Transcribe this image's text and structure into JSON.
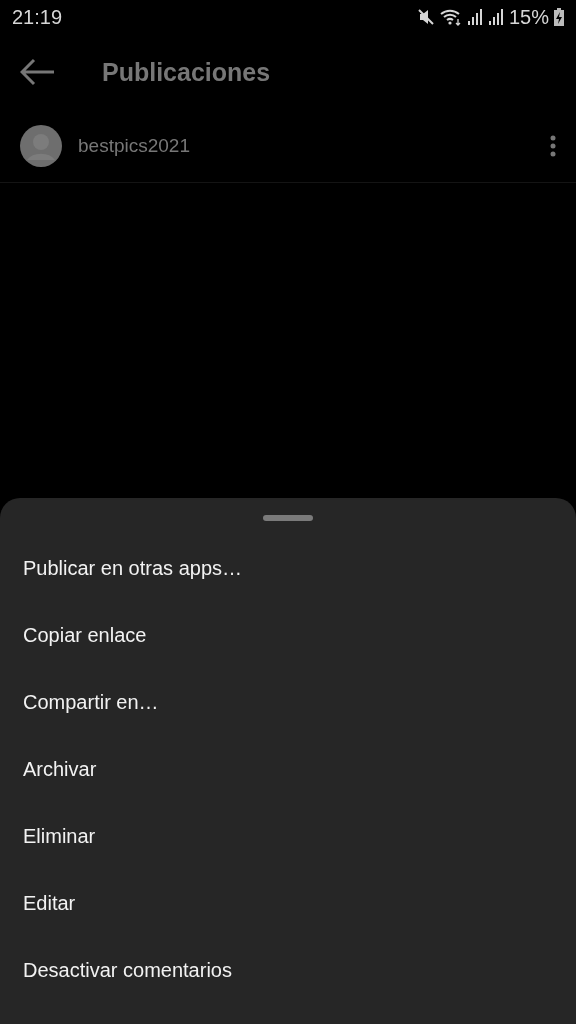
{
  "status_bar": {
    "time": "21:19",
    "battery": "15%"
  },
  "header": {
    "title": "Publicaciones"
  },
  "post": {
    "username": "bestpics2021"
  },
  "sheet": {
    "items": [
      {
        "label": "Publicar en otras apps…"
      },
      {
        "label": "Copiar enlace"
      },
      {
        "label": "Compartir en…"
      },
      {
        "label": "Archivar"
      },
      {
        "label": "Eliminar"
      },
      {
        "label": "Editar"
      },
      {
        "label": "Desactivar comentarios"
      }
    ]
  }
}
